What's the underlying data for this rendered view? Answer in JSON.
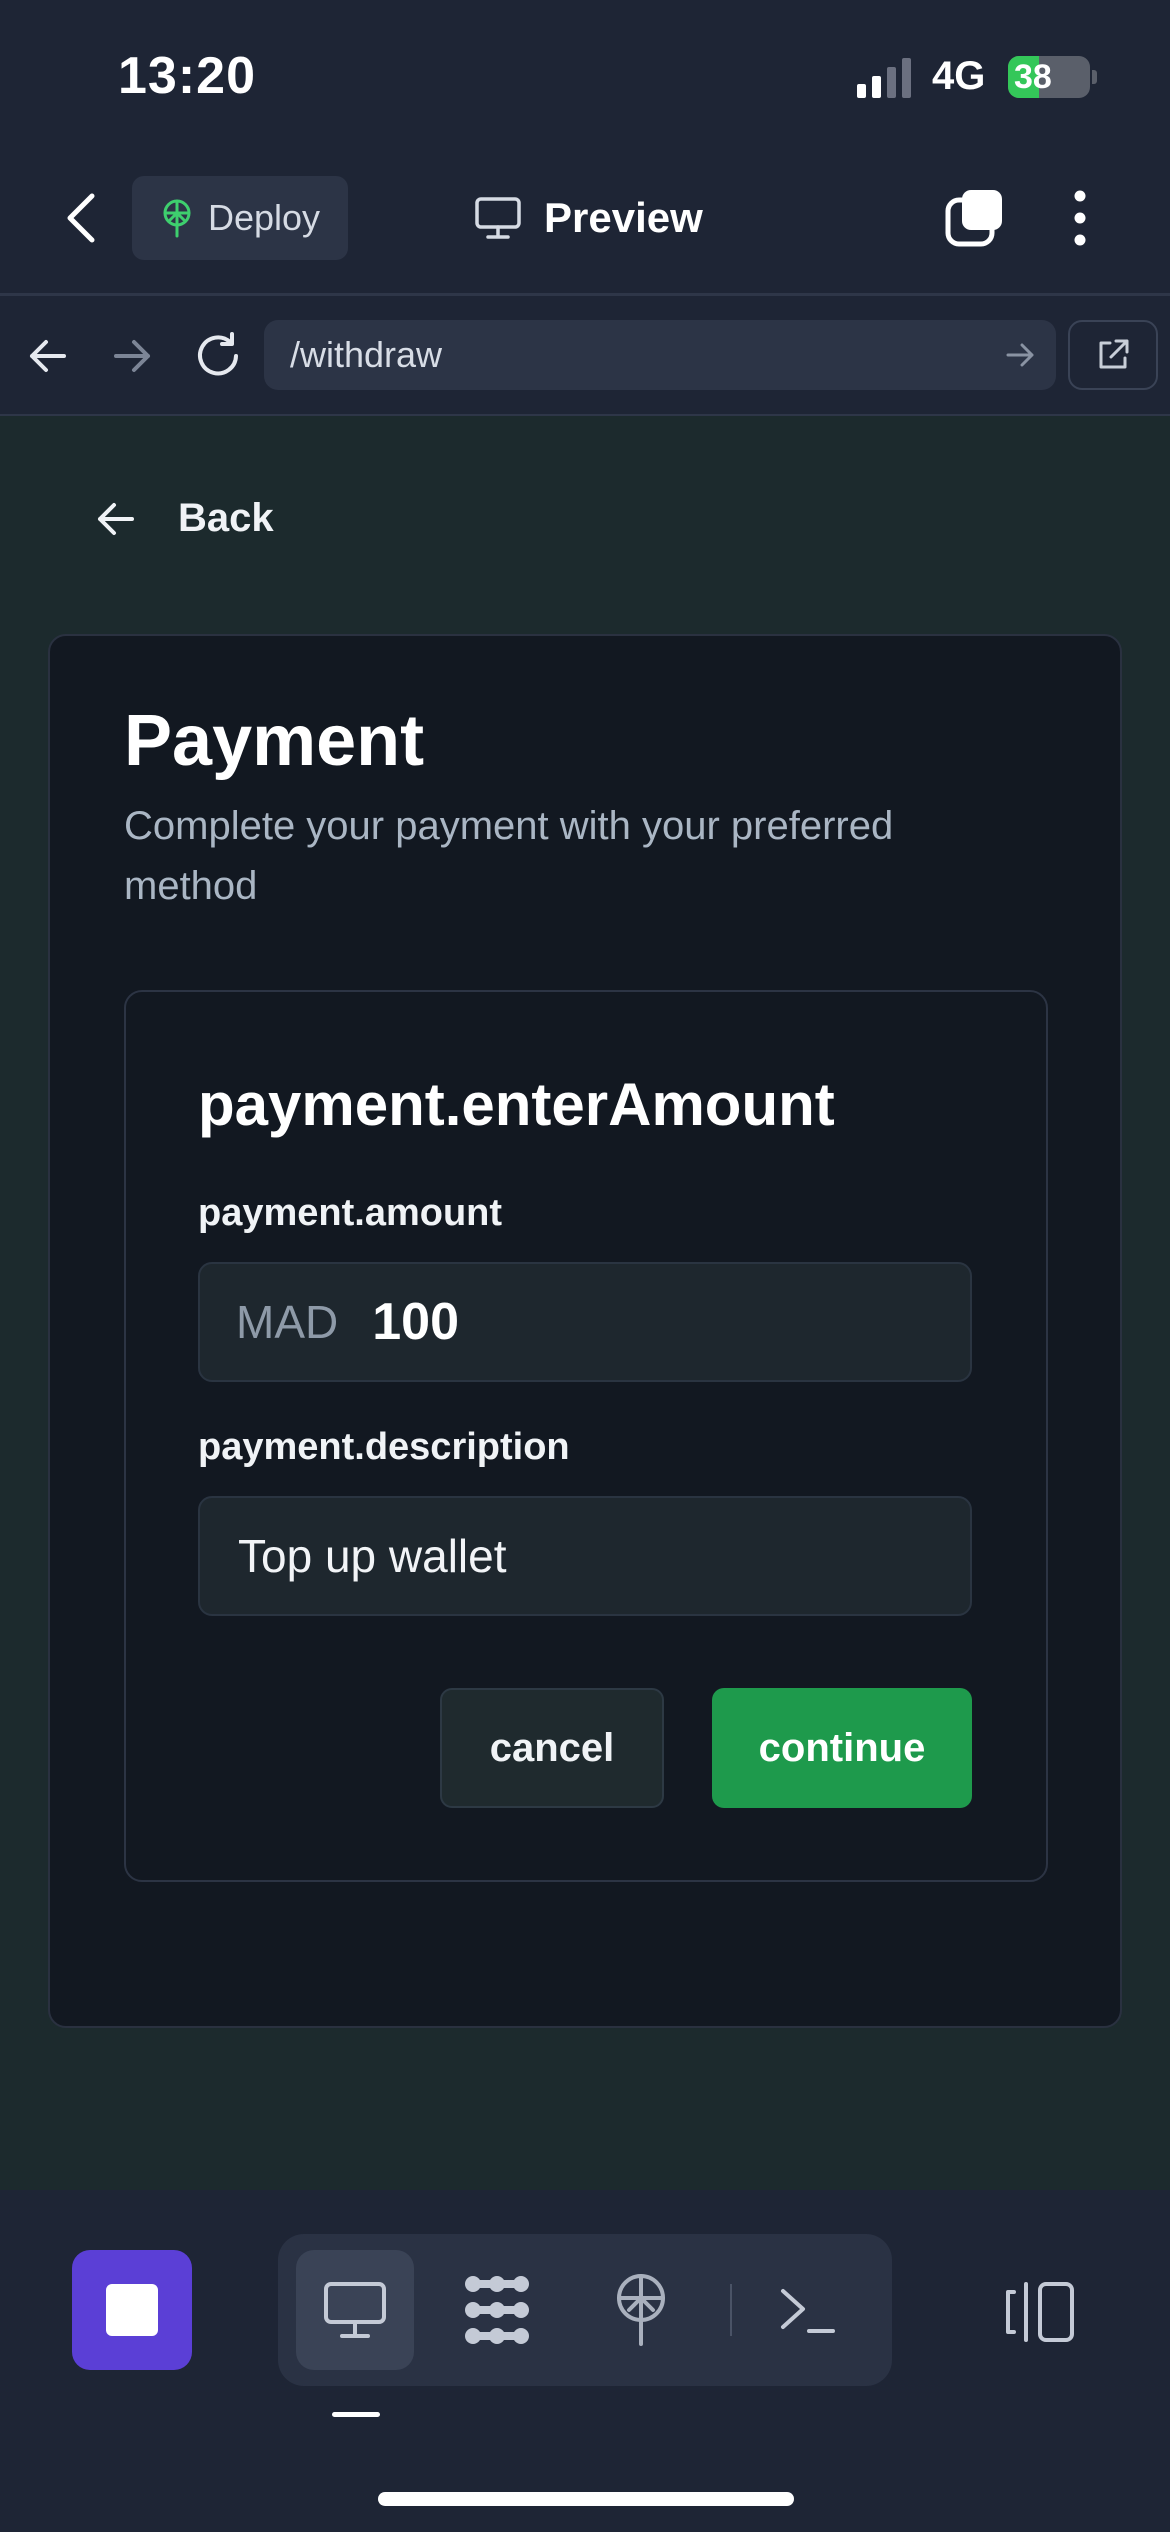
{
  "status_bar": {
    "time": "13:20",
    "network": "4G",
    "battery": "38",
    "battery_level": 0.38
  },
  "toolbar": {
    "deploy_label": "Deploy",
    "preview_label": "Preview"
  },
  "browser": {
    "url": "/withdraw"
  },
  "page": {
    "back_label": "Back",
    "title": "Payment",
    "subtitle": "Complete your payment with your preferred method",
    "form": {
      "heading": "payment.enterAmount",
      "amount_label": "payment.amount",
      "currency": "MAD",
      "amount_value": "100",
      "description_label": "payment.description",
      "description_value": "Top up wallet",
      "cancel_label": "cancel",
      "continue_label": "continue"
    }
  },
  "bottom_bar": {
    "icons": [
      "stop-icon",
      "desktop-icon",
      "nodes-icon",
      "deploy-icon",
      "terminal-icon",
      "panel-icon"
    ]
  },
  "colors": {
    "accent_purple": "#5b3fd6",
    "continue_green": "#1e9a4c",
    "battery_green": "#34c759"
  }
}
